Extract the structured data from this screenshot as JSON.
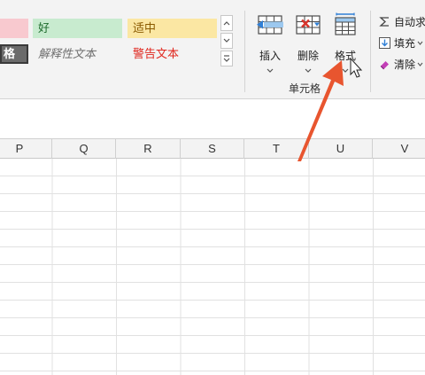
{
  "styles": {
    "good": "好",
    "neutral": "适中",
    "check_cell_partial": "格",
    "explanatory": "解释性文本",
    "warning": "警告文本"
  },
  "cells_group": {
    "insert_label": "插入",
    "delete_label": "删除",
    "format_label": "格式",
    "group_label": "单元格"
  },
  "editing_group": {
    "autosum_label": "自动求",
    "fill_label": "填充",
    "clear_label": "清除"
  },
  "columns": [
    "P",
    "Q",
    "R",
    "S",
    "T",
    "U",
    "V"
  ],
  "icons": {
    "insert": "insert-cells-icon",
    "delete": "delete-cells-icon",
    "format": "format-cells-icon",
    "autosum": "sigma-icon",
    "fill": "fill-down-icon",
    "clear": "eraser-icon",
    "annotation": "red-arrow-icon",
    "cursor": "mouse-pointer-icon"
  },
  "colors": {
    "annotation_arrow": "#e8552f",
    "good_bg": "#c8ebcf",
    "neutral_bg": "#fbe7a3",
    "warning_text": "#e0261d",
    "accent_blue": "#2f7fd6"
  }
}
